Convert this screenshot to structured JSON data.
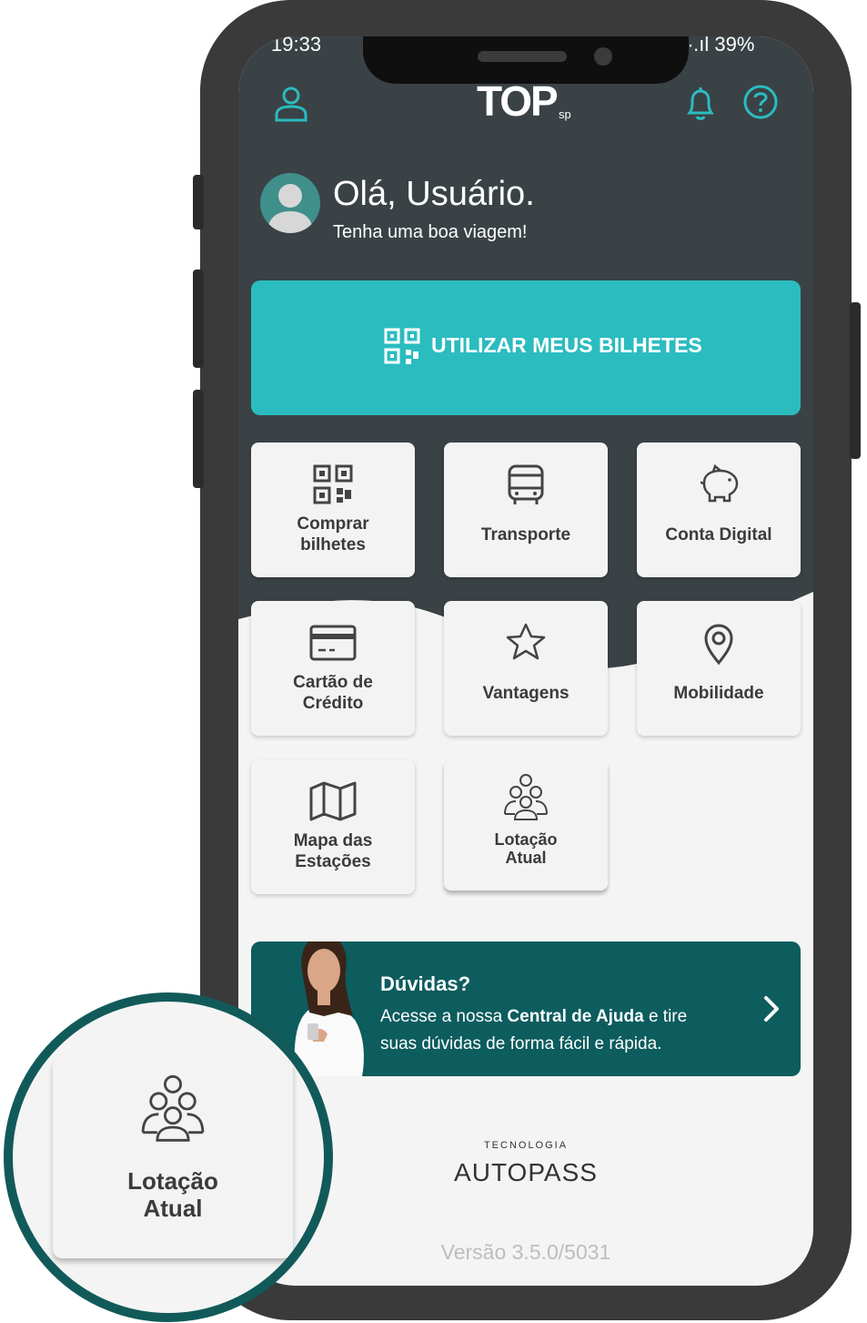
{
  "status": {
    "time": "19:33",
    "battery": "39%"
  },
  "header": {
    "logo": "TOP",
    "logo_suffix": "sp"
  },
  "greeting": {
    "title": "Olá, Usuário.",
    "subtitle": "Tenha uma boa viagem!"
  },
  "primary_action": {
    "label": "UTILIZAR MEUS BILHETES"
  },
  "tiles": [
    {
      "label": "Comprar\nbilhetes",
      "icon": "qr-code-icon"
    },
    {
      "label": "Transporte",
      "icon": "bus-icon"
    },
    {
      "label": "Conta Digital",
      "icon": "piggy-bank-icon"
    },
    {
      "label": "Cartão de\nCrédito",
      "icon": "credit-card-icon"
    },
    {
      "label": "Vantagens",
      "icon": "star-icon"
    },
    {
      "label": "Mobilidade",
      "icon": "map-pin-icon"
    },
    {
      "label": "Mapa das\nEstações",
      "icon": "map-icon"
    },
    {
      "label": "Lotação\nAtual",
      "icon": "crowd-icon"
    }
  ],
  "help_banner": {
    "title": "Dúvidas?",
    "text_before": "Acesse a nossa ",
    "text_bold": "Central de Ajuda",
    "text_after": " e tire suas dúvidas de forma fácil e rápida."
  },
  "footer": {
    "tech_label": "TECNOLOGIA",
    "brand": "AUTOPASS",
    "version": "Versão 3.5.0/5031"
  },
  "magnifier": {
    "label": "Lotação\nAtual"
  },
  "colors": {
    "dark": "#3a4246",
    "accent": "#2bbcc0",
    "teal_dark": "#0d5c5e"
  }
}
